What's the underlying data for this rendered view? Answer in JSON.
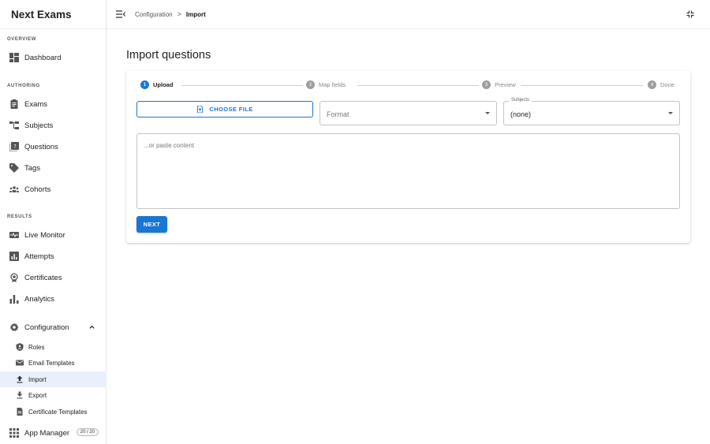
{
  "app": {
    "title": "Next Exams"
  },
  "sidebar": {
    "sections": {
      "overview": "OVERVIEW",
      "authoring": "AUTHORING",
      "results": "RESULTS"
    },
    "items": {
      "dashboard": "Dashboard",
      "exams": "Exams",
      "subjects": "Subjects",
      "questions": "Questions",
      "tags": "Tags",
      "cohorts": "Cohorts",
      "live_monitor": "Live Monitor",
      "attempts": "Attempts",
      "certificates": "Certificates",
      "analytics": "Analytics",
      "configuration": "Configuration"
    },
    "config_children": {
      "roles": "Roles",
      "email_templates": "Email Templates",
      "import": "Import",
      "export": "Export",
      "certificate_templates": "Certificate Templates"
    },
    "app_manager": {
      "label": "App Manager",
      "badge": "20 / 20"
    }
  },
  "topbar": {
    "breadcrumb": {
      "parent": "Configuration",
      "separator": ">",
      "current": "Import"
    }
  },
  "main": {
    "title": "Import questions",
    "steps": [
      {
        "num": "1",
        "label": "Upload",
        "active": true
      },
      {
        "num": "2",
        "label": "Map fields",
        "active": false
      },
      {
        "num": "3",
        "label": "Preview",
        "active": false
      },
      {
        "num": "4",
        "label": "Done",
        "active": false
      }
    ],
    "choose_file_label": "CHOOSE FILE",
    "format": {
      "placeholder": "Format"
    },
    "subjects": {
      "label": "Subjects",
      "value": "(none)"
    },
    "paste": {
      "placeholder": "...or paste content"
    },
    "next_label": "NEXT"
  },
  "colors": {
    "accent": "#1976d2",
    "active_nav_bg": "#e8f0fb"
  }
}
